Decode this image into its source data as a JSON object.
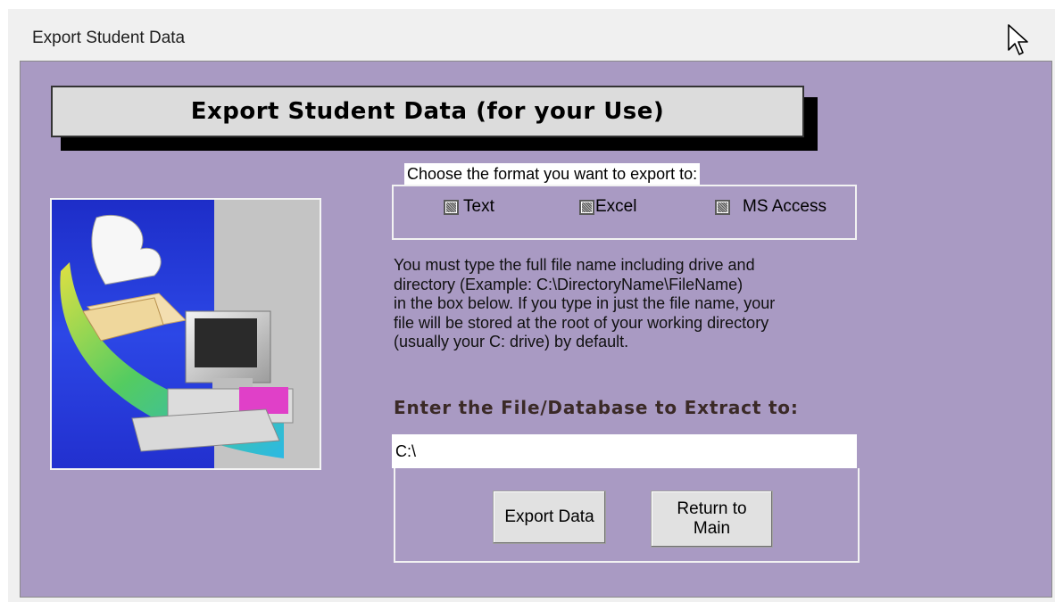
{
  "window": {
    "title": "Export Student Data"
  },
  "banner": {
    "text": "Export Student Data (for your Use)"
  },
  "format": {
    "legend": "Choose the format you want to export to:",
    "options": [
      {
        "label": "Text",
        "checked": true
      },
      {
        "label": "Excel",
        "checked": true
      },
      {
        "label": "MS Access",
        "checked": true
      }
    ]
  },
  "instructions": {
    "lines": [
      "You must type the full file name including drive and",
      "directory (Example:   C:\\DirectoryName\\FileName)",
      "in the box below.  If you type in just the file name, your",
      "file will be stored at the root of  your working directory",
      "(usually your C: drive) by default."
    ]
  },
  "extract": {
    "label": "Enter the File/Database to Extract to:",
    "value": "C:\\"
  },
  "buttons": {
    "export": "Export Data",
    "return_line1": "Return to",
    "return_line2": "Main"
  },
  "icons": {
    "cursor": "mouse-pointer-icon",
    "illustration": "computer-folder-clipart"
  },
  "colors": {
    "client_bg": "#a99ac3",
    "banner_bg": "#dcdcdc",
    "label_text": "#3b2a27"
  }
}
